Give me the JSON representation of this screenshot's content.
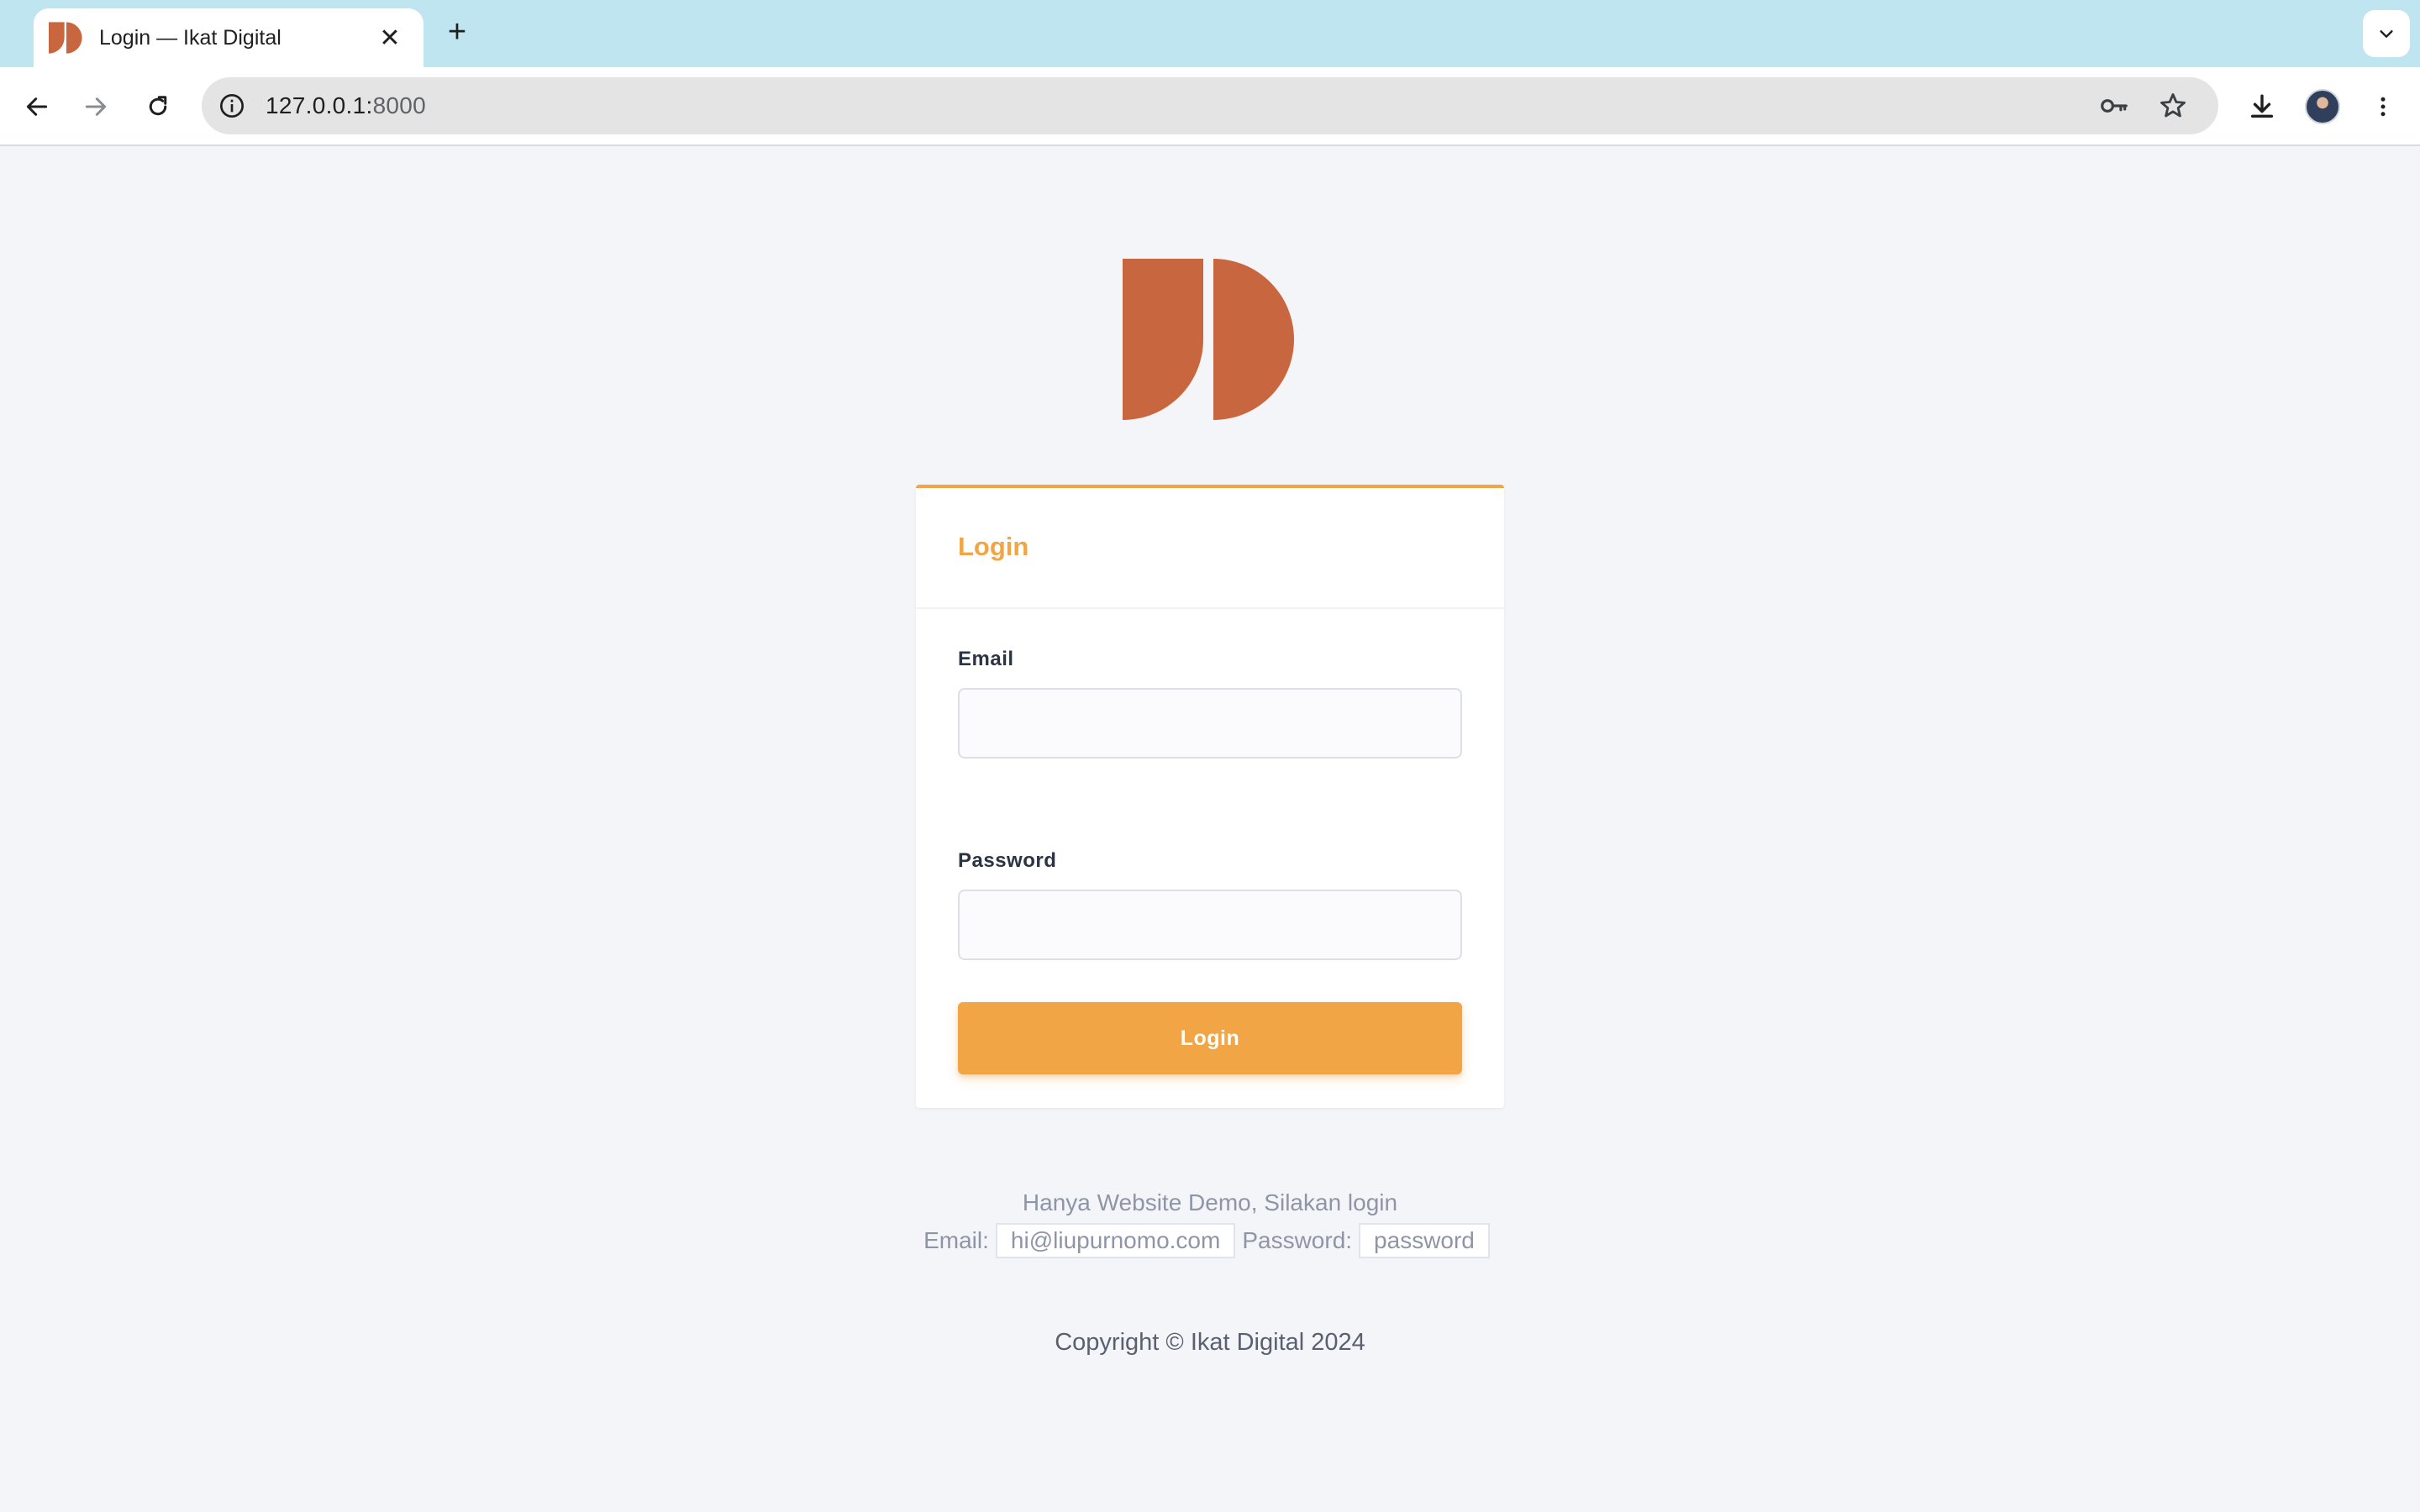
{
  "browser": {
    "tab_title": "Login — Ikat Digital",
    "url_host": "127.0.0.1:",
    "url_port": "8000",
    "icons": [
      "back-arrow-icon",
      "forward-arrow-icon",
      "reload-icon",
      "site-info-icon",
      "password-key-icon",
      "bookmark-star-icon",
      "download-icon",
      "profile-avatar",
      "menu-dots-icon",
      "tab-search-chevron-icon"
    ]
  },
  "brand": {
    "logo_color": "#c8673f",
    "accent": "#f2a545"
  },
  "login_form": {
    "title": "Login",
    "email_label": "Email",
    "email_value": "",
    "password_label": "Password",
    "password_value": "",
    "submit_label": "Login"
  },
  "demo": {
    "note": "Hanya Website Demo, Silakan login",
    "email_label": "Email:",
    "email_value": "hi@liupurnomo.com",
    "password_label": "Password:",
    "password_value": "password"
  },
  "footer": {
    "copyright": "Copyright © Ikat Digital 2024"
  }
}
